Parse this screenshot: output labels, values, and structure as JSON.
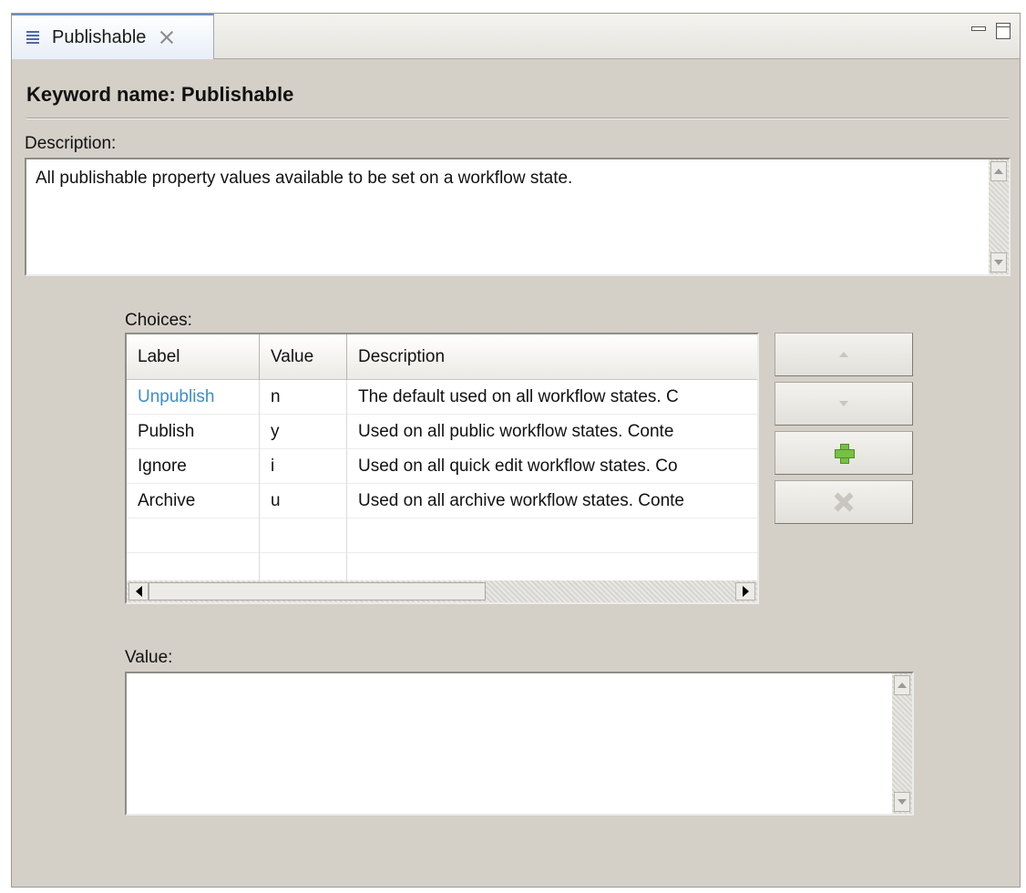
{
  "tab": {
    "title": "Publishable",
    "icon": "document-lines-icon",
    "close_icon": "close-icon"
  },
  "window_controls": {
    "minimize": "minimize-icon",
    "maximize": "maximize-icon"
  },
  "heading": "Keyword name: Publishable",
  "description": {
    "label": "Description:",
    "value": "All publishable property values available to be set on a workflow state."
  },
  "choices": {
    "label": "Choices:",
    "columns": [
      "Label",
      "Value",
      "Description"
    ],
    "rows": [
      {
        "label": "Unpublish",
        "value": "n",
        "description": "The default used on all workflow states. C"
      },
      {
        "label": "Publish",
        "value": "y",
        "description": "Used on all public workflow states. Conte"
      },
      {
        "label": "Ignore",
        "value": "i",
        "description": "Used on all quick edit workflow states. Co"
      },
      {
        "label": "Archive",
        "value": "u",
        "description": "Used on all archive workflow states. Conte"
      }
    ],
    "buttons": [
      {
        "name": "move-up-button",
        "icon": "arrow-up-icon",
        "enabled": false
      },
      {
        "name": "move-down-button",
        "icon": "arrow-down-icon",
        "enabled": false
      },
      {
        "name": "add-choice-button",
        "icon": "plus-icon",
        "enabled": true
      },
      {
        "name": "remove-choice-button",
        "icon": "x-icon",
        "enabled": false
      }
    ]
  },
  "value": {
    "label": "Value:",
    "value": ""
  },
  "colors": {
    "link": "#3c8ecb",
    "panel": "#d4d0c8",
    "add": "#76c043"
  }
}
